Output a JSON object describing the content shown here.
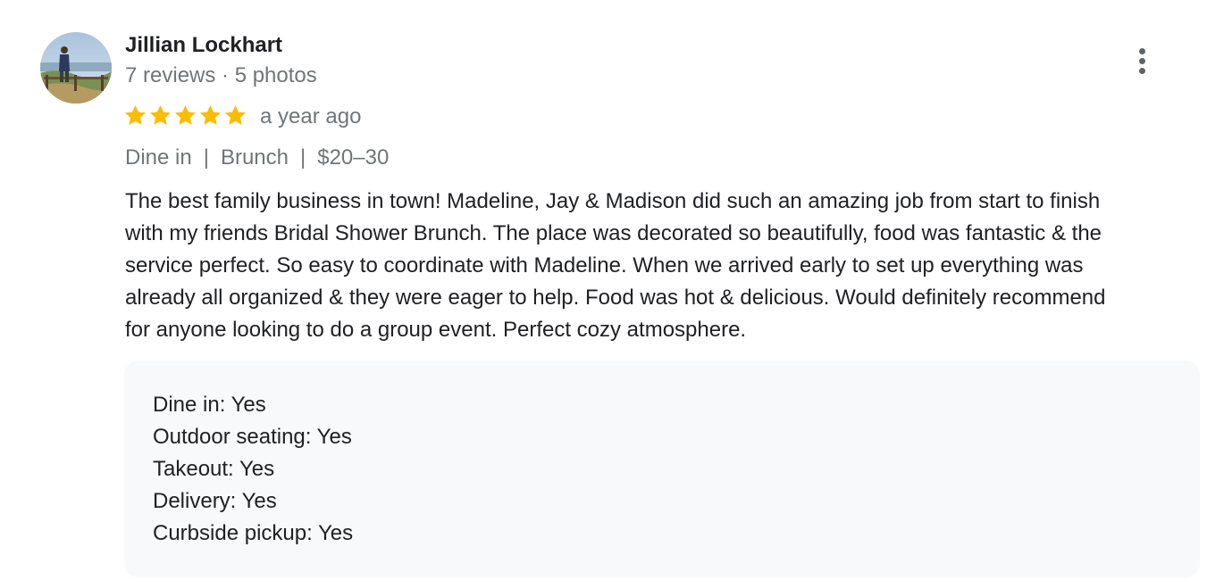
{
  "reviewer": {
    "name": "Jillian Lockhart",
    "meta": "7 reviews · 5 photos"
  },
  "rating": {
    "stars": 5,
    "max": 5,
    "time_ago": "a year ago"
  },
  "tags": [
    "Dine in",
    "Brunch",
    "$20–30"
  ],
  "tag_separator": "|",
  "review_lines": [
    "The best family business in town! Madeline, Jay & Madison did such an amazing job from start to finish",
    "with my friends Bridal Shower Brunch. The place was decorated so beautifully, food was fantastic & the",
    "service perfect. So easy to coordinate with Madeline. When we arrived early to set up everything was",
    "already all organized & they were eager to help. Food was hot & delicious. Would definitely recommend",
    "for anyone looking to do a group event. Perfect cozy atmosphere."
  ],
  "attributes": [
    "Dine in: Yes",
    "Outdoor seating: Yes",
    "Takeout: Yes",
    "Delivery: Yes",
    "Curbside pickup: Yes"
  ],
  "icons": {
    "star": "star-icon",
    "more": "more-vert-icon"
  },
  "colors": {
    "star": "#fbbc04",
    "secondary_text": "#70757a",
    "primary_text": "#202124",
    "attributes_bg": "#f8f9fa"
  }
}
